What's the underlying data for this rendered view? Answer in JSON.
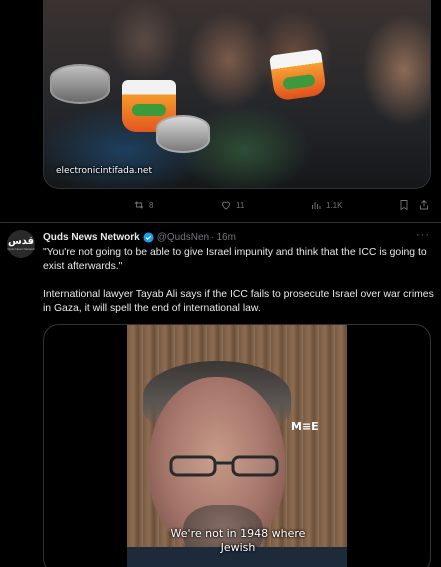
{
  "previous_tweet": {
    "media": {
      "caption": "electronicintifada.net",
      "alt": "Children holding pots and buckets"
    },
    "actions": {
      "retweets": "8",
      "likes": "11",
      "views": "1.1K"
    }
  },
  "tweet": {
    "avatar_logo": "قدس",
    "avatar_sub": "Quds News Network",
    "author_name": "Quds News Network",
    "handle": "@QudsNen",
    "separator": "·",
    "time": "16m",
    "more": "···",
    "paragraphs": [
      "\"You're not going to be able to give Israel impunity and think that the ICC is going to exist afterwards.\"",
      "International lawyer Tayab Ali says if the ICC fails to prosecute Israel over war crimes in Gaza, it will spell the end of international law."
    ],
    "video": {
      "watermark": "M≡E",
      "subtitle_line1": "We're not in 1948 where",
      "subtitle_line2": "Jewish"
    }
  },
  "colors": {
    "background": "#000000",
    "text": "#e7e9ea",
    "muted": "#71767b",
    "border": "#2f3336",
    "verified": "#1d9bf0"
  }
}
